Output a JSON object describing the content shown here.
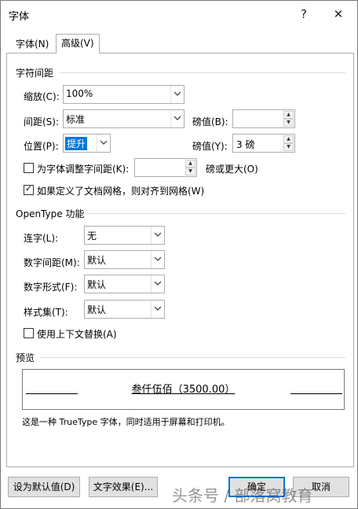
{
  "window": {
    "title": "字体",
    "help_label": "?",
    "close_label": "✕"
  },
  "tabs": [
    {
      "label": "字体(N)",
      "active": false
    },
    {
      "label": "高级(V)",
      "active": true
    }
  ],
  "char_spacing": {
    "section_title": "字符间距",
    "scale_label": "缩放(C):",
    "scale_value": "100%",
    "spacing_label": "间距(S):",
    "spacing_value": "标准",
    "spacing_by_label": "磅值(B):",
    "spacing_by_value": "",
    "position_label": "位置(P):",
    "position_value": "提升",
    "position_by_label": "磅值(Y):",
    "position_by_value": "3 磅",
    "kerning_label": "为字体调整字间距(K):",
    "kerning_checked": false,
    "kerning_value": "",
    "kerning_suffix": "磅或更大(O)",
    "grid_label": "如果定义了文档网格，则对齐到网格(W)",
    "grid_checked": true
  },
  "opentype": {
    "section_title": "OpenType 功能",
    "ligatures_label": "连字(L):",
    "ligatures_value": "无",
    "num_spacing_label": "数字间距(M):",
    "num_spacing_value": "默认",
    "num_forms_label": "数字形式(F):",
    "num_forms_value": "默认",
    "stylistic_label": "样式集(T):",
    "stylistic_value": "默认",
    "contextual_label": "使用上下文替换(A)",
    "contextual_checked": false
  },
  "preview": {
    "section_title": "预览",
    "sample_text": "叁仟伍佰（3500.00）",
    "description": "这是一种 TrueType 字体，同时适用于屏幕和打印机。"
  },
  "footer": {
    "set_default_label": "设为默认值(D)",
    "text_effects_label": "文字效果(E)...",
    "ok_label": "确定",
    "cancel_label": "取消"
  },
  "watermark": "头条号 / 部落窝教育"
}
